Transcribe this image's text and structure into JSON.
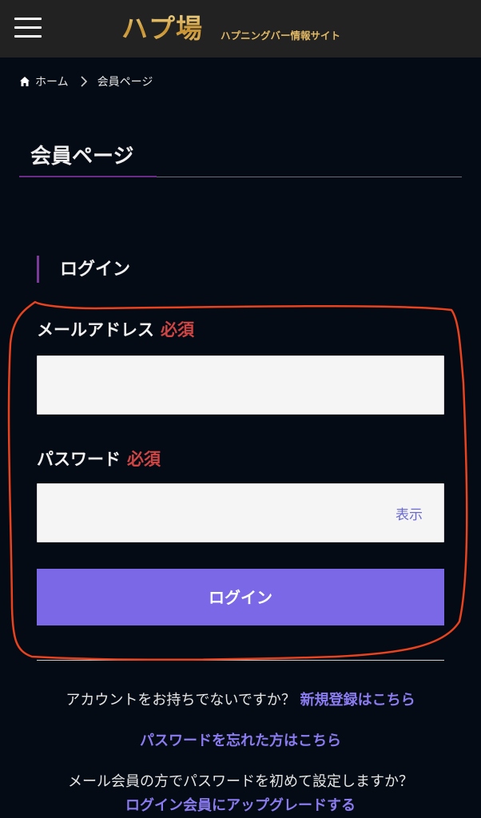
{
  "header": {
    "logo_main": "ハプ場",
    "logo_sub": "ハプニングバー情報サイト"
  },
  "breadcrumb": {
    "home": "ホーム",
    "current": "会員ページ"
  },
  "page": {
    "title": "会員ページ"
  },
  "login": {
    "heading": "ログイン",
    "email_label": "メールアドレス",
    "password_label": "パスワード",
    "required": "必須",
    "email_value": "",
    "password_value": "",
    "show_toggle": "表示",
    "button": "ログイン"
  },
  "footer_links": {
    "no_account_text": "アカウントをお持ちでないですか？",
    "register_link": "新規登録はこちら",
    "forgot_password_link": "パスワードを忘れた方はこちら",
    "mail_member_text": "メール会員の方でパスワードを初めて設定しますか？",
    "upgrade_link": "ログイン会員にアップグレードする"
  },
  "colors": {
    "background": "#040b14",
    "header": "#222222",
    "logo_gold": "#e0b865",
    "accent_purple": "#7b68e6",
    "required_red": "#d14444",
    "annotation_red": "#e8421e"
  },
  "icons": [
    "hamburger-menu-icon",
    "home-icon",
    "chevron-right-icon"
  ]
}
